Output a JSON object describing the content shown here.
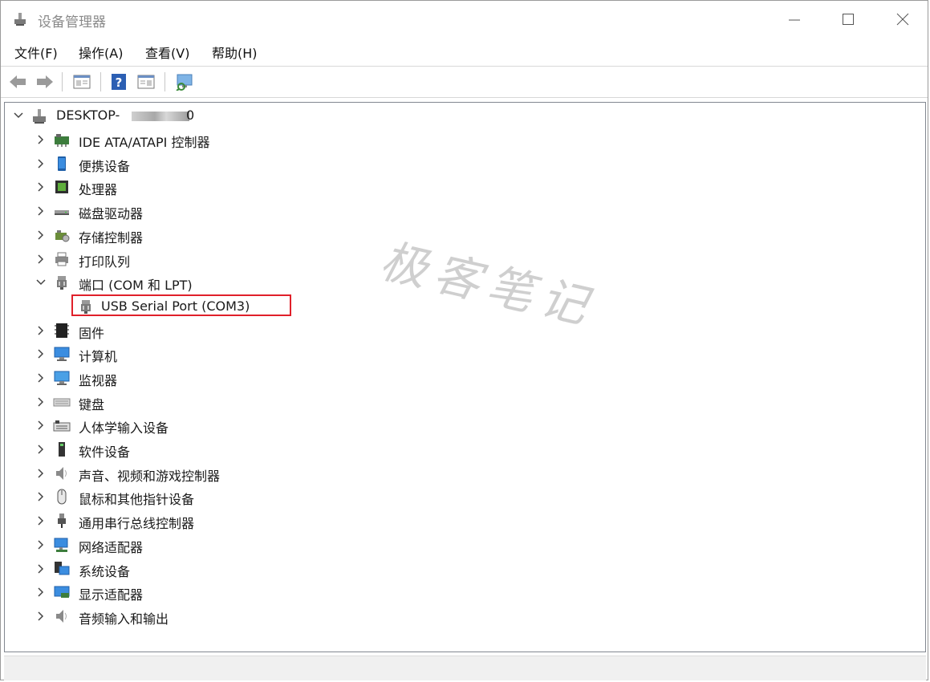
{
  "window": {
    "title": "设备管理器",
    "controls": {
      "minimize": "—",
      "maximize": "☐",
      "close": "✕"
    }
  },
  "menu": [
    "文件(F)",
    "操作(A)",
    "查看(V)",
    "帮助(H)"
  ],
  "toolbar": {
    "icons": [
      "back-arrow-icon",
      "forward-arrow-icon",
      "properties-window-icon",
      "help-icon",
      "show-hide-console-tree-icon",
      "scan-hardware-icon"
    ]
  },
  "tree": {
    "root": "DESKTOP-",
    "root_suffix": "0",
    "items": [
      {
        "label": "IDE ATA/ATAPI 控制器",
        "icon": "ide-controller-icon",
        "expanded": false
      },
      {
        "label": "便携设备",
        "icon": "portable-device-icon",
        "expanded": false
      },
      {
        "label": "处理器",
        "icon": "processor-icon",
        "expanded": false
      },
      {
        "label": "磁盘驱动器",
        "icon": "disk-drive-icon",
        "expanded": false
      },
      {
        "label": "存储控制器",
        "icon": "storage-controller-icon",
        "expanded": false
      },
      {
        "label": "打印队列",
        "icon": "printer-icon",
        "expanded": false
      },
      {
        "label": "端口 (COM 和 LPT)",
        "icon": "port-icon",
        "expanded": true
      },
      {
        "label": "固件",
        "icon": "firmware-icon",
        "expanded": false
      },
      {
        "label": "计算机",
        "icon": "computer-icon",
        "expanded": false
      },
      {
        "label": "监视器",
        "icon": "monitor-icon",
        "expanded": false
      },
      {
        "label": "键盘",
        "icon": "keyboard-icon",
        "expanded": false
      },
      {
        "label": "人体学输入设备",
        "icon": "hid-icon",
        "expanded": false
      },
      {
        "label": "软件设备",
        "icon": "software-device-icon",
        "expanded": false
      },
      {
        "label": "声音、视频和游戏控制器",
        "icon": "sound-icon",
        "expanded": false
      },
      {
        "label": "鼠标和其他指针设备",
        "icon": "mouse-icon",
        "expanded": false
      },
      {
        "label": "通用串行总线控制器",
        "icon": "usb-controller-icon",
        "expanded": false
      },
      {
        "label": "网络适配器",
        "icon": "network-adapter-icon",
        "expanded": false
      },
      {
        "label": "系统设备",
        "icon": "system-device-icon",
        "expanded": false
      },
      {
        "label": "显示适配器",
        "icon": "display-adapter-icon",
        "expanded": false
      },
      {
        "label": "音频输入和输出",
        "icon": "audio-io-icon",
        "expanded": false
      }
    ],
    "port_child": "USB Serial Port (COM3)"
  },
  "watermark": "极客笔记",
  "colors": {
    "highlight": "#e0202a",
    "accent": "#3a7bd5"
  }
}
